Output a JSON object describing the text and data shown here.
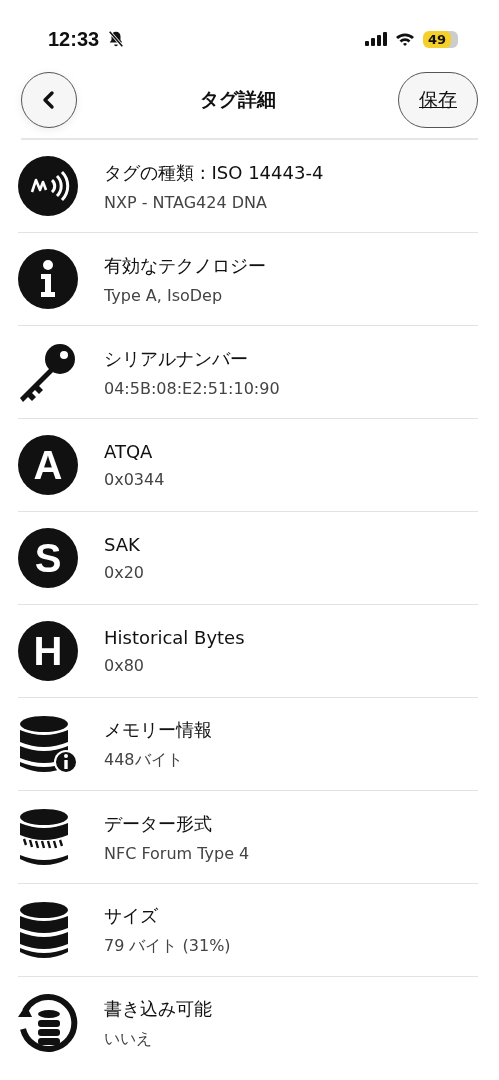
{
  "status_bar": {
    "time": "12:33",
    "battery": "49"
  },
  "header": {
    "title": "タグ詳細",
    "save_button": "保存"
  },
  "rows": [
    {
      "kind": "nfc",
      "title": "タグの種類 : ISO 14443-4",
      "value": "NXP - NTAG424 DNA"
    },
    {
      "kind": "info",
      "title": "有効なテクノロジー",
      "value": "Type A, IsoDep"
    },
    {
      "kind": "key",
      "title": "シリアルナンバー",
      "value": "04:5B:08:E2:51:10:90"
    },
    {
      "kind": "letter",
      "letter": "A",
      "title": "ATQA",
      "value": "0x0344"
    },
    {
      "kind": "letter",
      "letter": "S",
      "title": "SAK",
      "value": "0x20"
    },
    {
      "kind": "letter",
      "letter": "H",
      "title": "Historical Bytes",
      "value": "0x80"
    },
    {
      "kind": "database-info",
      "title": "メモリー情報",
      "value": "448バイト"
    },
    {
      "kind": "database-format",
      "title": "データー形式",
      "value": "NFC Forum Type 4"
    },
    {
      "kind": "database",
      "title": "サイズ",
      "value": "79 バイト (31%)"
    },
    {
      "kind": "database-sync",
      "title": "書き込み可能",
      "value": "いいえ"
    }
  ]
}
